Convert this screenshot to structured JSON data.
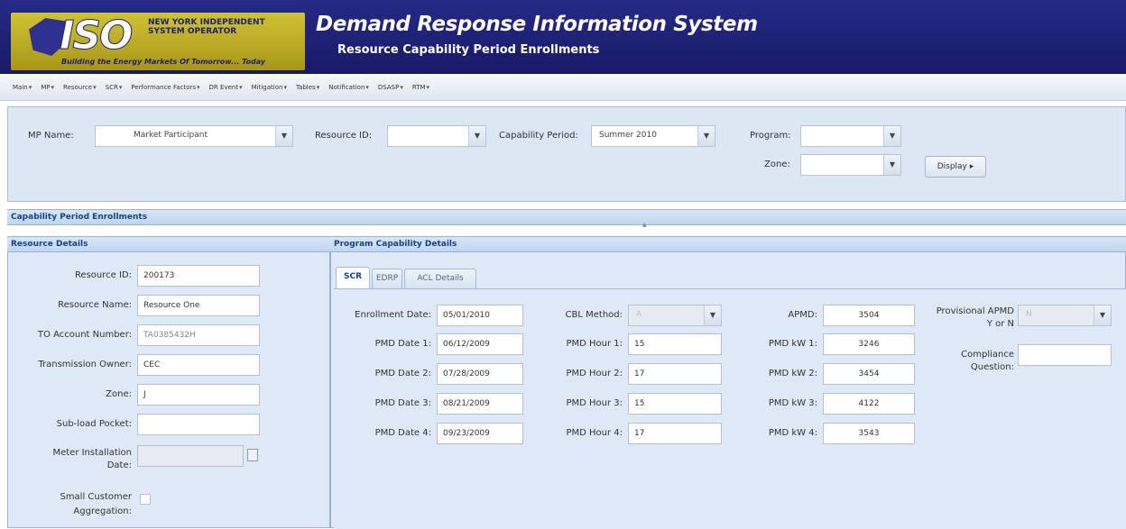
{
  "header": {
    "logo_text": "ISO",
    "org_name": "NEW YORK INDEPENDENT SYSTEM OPERATOR",
    "tagline": "Building the Energy Markets Of Tomorrow... Today",
    "title": "Demand Response Information System",
    "subtitle": "Resource Capability Period Enrollments"
  },
  "menu": [
    "Main",
    "MP",
    "Resource",
    "SCR",
    "Performance Factors",
    "DR Event",
    "Mitigation",
    "Tables",
    "Notification",
    "DSASP",
    "RTM"
  ],
  "filters": {
    "mp_name_label": "MP Name:",
    "mp_name_value": "Market Participant",
    "resource_id_label": "Resource ID:",
    "resource_id_value": "",
    "capability_period_label": "Capability Period:",
    "capability_period_value": "Summer 2010",
    "program_label": "Program:",
    "program_value": "",
    "zone_label": "Zone:",
    "zone_value": "",
    "display_button": "Display"
  },
  "section_title": "Capability Period Enrollments",
  "resource_details": {
    "title": "Resource Details",
    "resource_id_label": "Resource ID:",
    "resource_id": "200173",
    "resource_name_label": "Resource Name:",
    "resource_name": "Resource One",
    "to_account_label": "TO Account Number:",
    "to_account": "TA0385432H",
    "transmission_owner_label": "Transmission Owner:",
    "transmission_owner": "CEC",
    "zone_label": "Zone:",
    "zone": "J",
    "subload_label": "Sub-load Pocket:",
    "subload": "",
    "meter_label_1": "Meter Installation",
    "meter_label_2": "Date:",
    "small_customer_label_1": "Small Customer",
    "small_customer_label_2": "Aggregation:"
  },
  "program_details": {
    "title": "Program Capability Details",
    "tabs": [
      "SCR",
      "EDRP",
      "ACL Details"
    ],
    "enrollment_date_label": "Enrollment Date:",
    "enrollment_date": "05/01/2010",
    "pmd_dates": [
      {
        "label": "PMD Date 1:",
        "value": "06/12/2009"
      },
      {
        "label": "PMD Date 2:",
        "value": "07/28/2009"
      },
      {
        "label": "PMD Date 3:",
        "value": "08/21/2009"
      },
      {
        "label": "PMD Date 4:",
        "value": "09/23/2009"
      }
    ],
    "cbl_method_label": "CBL Method:",
    "cbl_method": "A",
    "pmd_hours": [
      {
        "label": "PMD Hour 1:",
        "value": "15"
      },
      {
        "label": "PMD Hour 2:",
        "value": "17"
      },
      {
        "label": "PMD Hour 3:",
        "value": "15"
      },
      {
        "label": "PMD Hour 4:",
        "value": "17"
      }
    ],
    "apmd_label": "APMD:",
    "apmd": "3504",
    "pmd_kws": [
      {
        "label": "PMD kW 1:",
        "value": "3246"
      },
      {
        "label": "PMD kW 2:",
        "value": "3454"
      },
      {
        "label": "PMD kW 3:",
        "value": "4122"
      },
      {
        "label": "PMD kW 4:",
        "value": "3543"
      }
    ],
    "provisional_apmd_label_1": "Provisional APMD",
    "provisional_apmd_label_2": "Y or N",
    "provisional_apmd": "N",
    "compliance_label_1": "Compliance",
    "compliance_label_2": "Question:",
    "compliance": ""
  }
}
